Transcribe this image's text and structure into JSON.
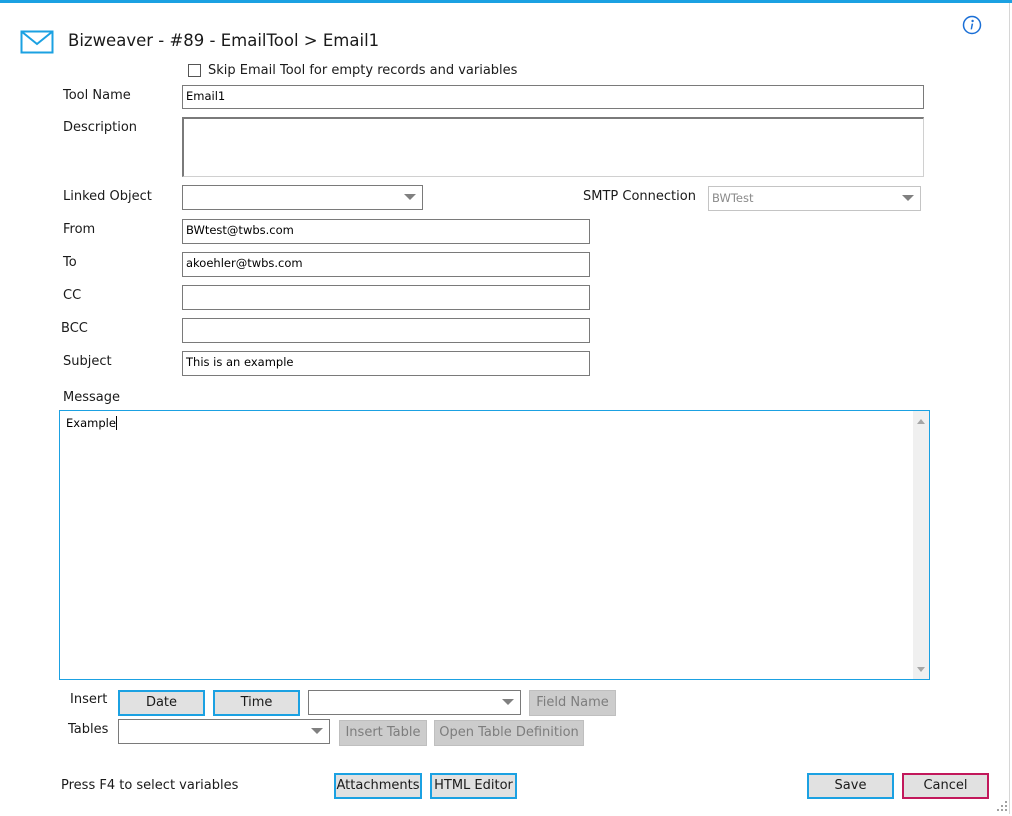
{
  "window": {
    "title": "Bizweaver - #89 - EmailTool > Email1",
    "accent_color": "#1ba1e2",
    "cancel_border_color": "#c2185b"
  },
  "icons": {
    "app": "envelope-icon",
    "info": "info-icon"
  },
  "options": {
    "skip_label": "Skip Email Tool for empty records and variables",
    "skip_checked": false
  },
  "fields": {
    "tool_name_label": "Tool Name",
    "tool_name_value": "Email1",
    "description_label": "Description",
    "description_value": "",
    "linked_object_label": "Linked Object",
    "linked_object_value": "",
    "smtp_label": "SMTP Connection",
    "smtp_value": "BWTest",
    "from_label": "From",
    "from_value": "BWtest@twbs.com",
    "to_label": "To",
    "to_value": "akoehler@twbs.com",
    "cc_label": "CC",
    "cc_value": "",
    "bcc_label": "BCC",
    "bcc_value": "",
    "subject_label": "Subject",
    "subject_value": "This is an example"
  },
  "message": {
    "label": "Message",
    "body": "Example"
  },
  "insert": {
    "label": "Insert",
    "date_button": "Date",
    "time_button": "Time",
    "field_select_value": "",
    "field_name_button": "Field Name"
  },
  "tables": {
    "label": "Tables",
    "select_value": "",
    "insert_table_button": "Insert Table",
    "open_definition_button": "Open Table Definition"
  },
  "footer": {
    "hint": "Press F4 to select variables",
    "attachments_button": "Attachments",
    "html_editor_button": "HTML Editor",
    "save_button": "Save",
    "cancel_button": "Cancel"
  }
}
